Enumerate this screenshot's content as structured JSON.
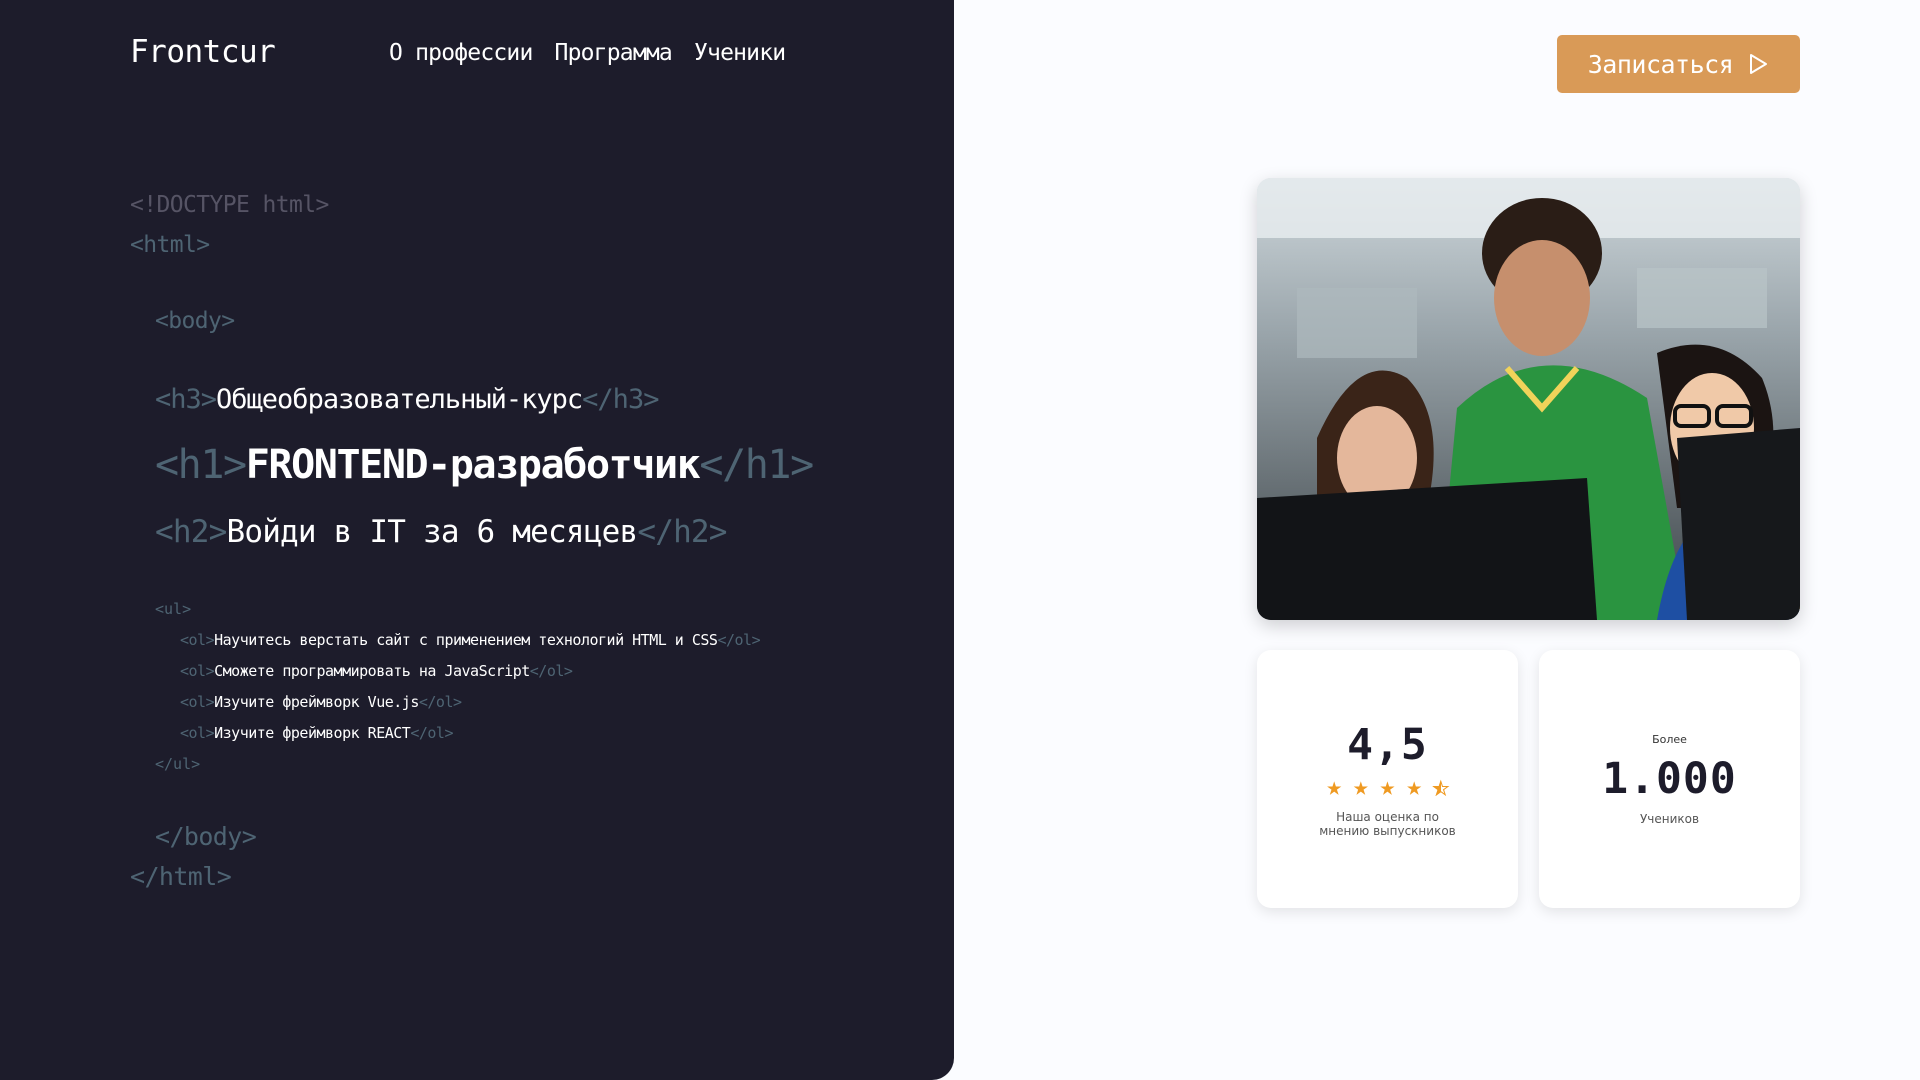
{
  "brand": {
    "logo": "Frontcur"
  },
  "nav": {
    "items": [
      "О профессии",
      "Программа",
      "Ученики"
    ]
  },
  "cta": {
    "label": "Записаться"
  },
  "code": {
    "doctype": "<!DOCTYPE html>",
    "html_open": "<html>",
    "body_open": "<body>",
    "h3_open": "<h3>",
    "h3_text": "Общеобразовательный-курс",
    "h3_close": "</h3>",
    "h1_open": "<h1>",
    "h1_text": "FRONTEND-разработчик",
    "h1_close": "</h1>",
    "h2_open": "<h2>",
    "h2_text": "Войди в IT за 6 месяцев",
    "h2_close": "</h2>",
    "ul_open": "<ul>",
    "ol_open": "<ol>",
    "ol_close": "</ol>",
    "items": [
      "Научитесь верстать сайт с применением технологий HTML и CSS",
      "Сможете программировать на JavaScript",
      "Изучите фреймворк Vue.js",
      "Изучите фреймворк REACT"
    ],
    "ul_close": "</ul>",
    "body_close": "</body>",
    "html_close": "</html>"
  },
  "rating_card": {
    "value": "4,5",
    "stars": 4.5,
    "caption_line1": "Наша оценка по",
    "caption_line2": "мнению выпускников"
  },
  "students_card": {
    "prefix": "Более",
    "value": "1.000",
    "caption": "Учеников"
  },
  "colors": {
    "panel": "#1d1c2b",
    "accent": "#d99a57",
    "star": "#ef9a22",
    "tag": "#4e6473"
  }
}
